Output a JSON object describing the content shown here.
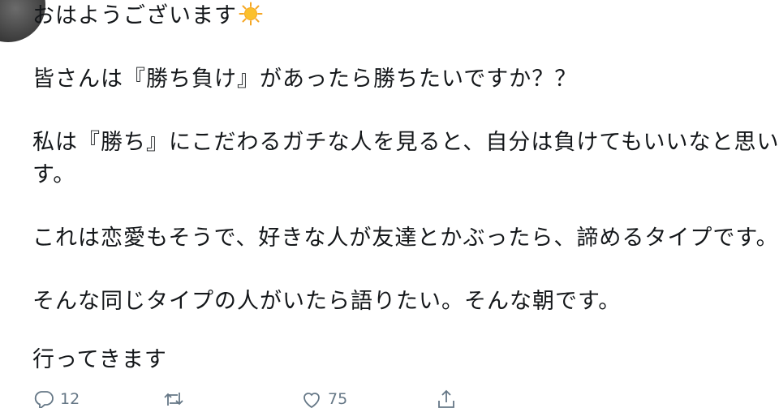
{
  "tweet": {
    "lines": [
      "おはようございます",
      "皆さんは『勝ち負け』があったら勝ちたいですか？？",
      "私は『勝ち』にこだわるガチな人を見ると、自分は負けてもいいなと思いま",
      "す。",
      "これは恋愛もそうで、好きな人が友達とかぶったら、諦めるタイプです。",
      "そんな同じタイプの人がいたら語りたい。そんな朝です。",
      "行ってきます"
    ],
    "emoji": "sun-icon"
  },
  "actions": {
    "reply_count": "12",
    "retweet_count": "",
    "like_count": "75"
  },
  "colors": {
    "text": "#14171a",
    "action": "#657786",
    "sun": "#f5a623"
  }
}
